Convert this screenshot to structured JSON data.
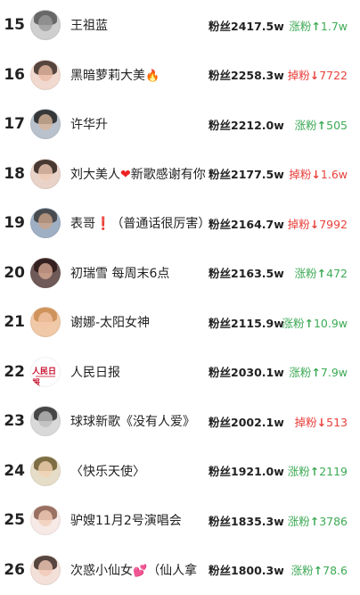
{
  "entries": [
    {
      "rank": "15",
      "name": "王祖蓝",
      "fans": "粉丝2417.5w",
      "change": "涨粉",
      "arrow": "↑",
      "delta": "1.7w",
      "dir": "up",
      "avatar": {
        "bg": "#cfcfcf",
        "face": "#9a9a9a",
        "hair": "#555555"
      }
    },
    {
      "rank": "16",
      "name": "黑暗萝莉大美",
      "emoji": "🔥",
      "fans": "粉丝2258.3w",
      "change": "掉粉",
      "arrow": "↓",
      "delta": "7722",
      "dir": "down",
      "avatar": {
        "bg": "#f2d9cf",
        "face": "#e8b9a3",
        "hair": "#3b2a24"
      }
    },
    {
      "rank": "17",
      "name": "许华升",
      "fans": "粉丝2212.0w",
      "change": "涨粉",
      "arrow": "↑",
      "delta": "505",
      "dir": "up",
      "avatar": {
        "bg": "#b9c2cc",
        "face": "#d7b49a",
        "hair": "#1f1f1f"
      }
    },
    {
      "rank": "18",
      "name": "刘大美人",
      "heart": "❤",
      "name2": "新歌感谢有你",
      "fans": "粉丝2177.5w",
      "change": "掉粉",
      "arrow": "↓",
      "delta": "1.6w",
      "dir": "down",
      "avatar": {
        "bg": "#e9d3c8",
        "face": "#efc9b3",
        "hair": "#2a1d18"
      }
    },
    {
      "rank": "19",
      "name": "表哥",
      "excl": "❗",
      "name2": "（普通话很厉害）",
      "fans": "粉丝2164.7w",
      "change": "掉粉",
      "arrow": "↓",
      "delta": "7992",
      "dir": "down",
      "avatar": {
        "bg": "#9fb0c4",
        "face": "#c9a28a",
        "hair": "#3a3a3a"
      }
    },
    {
      "rank": "20",
      "name": "初瑞雪 每周末6点",
      "fans": "粉丝2163.5w",
      "change": "涨粉",
      "arrow": "↑",
      "delta": "472",
      "dir": "up",
      "avatar": {
        "bg": "#6f5a58",
        "face": "#d8a995",
        "hair": "#2a1616"
      }
    },
    {
      "rank": "21",
      "name": "谢娜-太阳女神",
      "fans": "粉丝2115.9w",
      "change": "涨粉",
      "arrow": "↑",
      "delta": "10.9w",
      "dir": "up",
      "avatar": {
        "bg": "#f0c9a8",
        "face": "#f2c6a6",
        "hair": "#c98a4f"
      }
    },
    {
      "rank": "22",
      "name": "人民日报",
      "fans": "粉丝2030.1w",
      "change": "涨粉",
      "arrow": "↑",
      "delta": "7.9w",
      "dir": "up",
      "logo": "人民日报",
      "avatar": {
        "bg": "#ffffff",
        "face": "#ffffff",
        "hair": "#ffffff"
      }
    },
    {
      "rank": "23",
      "name": "球球新歌《没有人爱》",
      "fans": "粉丝2002.1w",
      "change": "掉粉",
      "arrow": "↓",
      "delta": "513",
      "dir": "down",
      "avatar": {
        "bg": "#d9d9d9",
        "face": "#bdbdbd",
        "hair": "#2b2b2b"
      }
    },
    {
      "rank": "24",
      "name": "〈快乐天使〉",
      "fans": "粉丝1921.0w",
      "change": "涨粉",
      "arrow": "↑",
      "delta": "2119",
      "dir": "up",
      "avatar": {
        "bg": "#e6ddc8",
        "face": "#f3d2b3",
        "hair": "#6b5a2d"
      }
    },
    {
      "rank": "25",
      "name": "驴嫂11月2号演唱会",
      "fans": "粉丝1835.3w",
      "change": "涨粉",
      "arrow": "↑",
      "delta": "3786",
      "dir": "up",
      "avatar": {
        "bg": "#f6e9e6",
        "face": "#f3cdb9",
        "hair": "#8a5b4a"
      }
    },
    {
      "rank": "26",
      "name": "次惑小仙女",
      "emoji": "💕",
      "name2": "（仙人拿",
      "fans": "粉丝1800.3w",
      "change": "涨粉",
      "arrow": "↑",
      "delta": "78.6",
      "dir": "up",
      "avatar": {
        "bg": "#f3e0d8",
        "face": "#f1c8b6",
        "hair": "#3b2a24"
      }
    }
  ]
}
